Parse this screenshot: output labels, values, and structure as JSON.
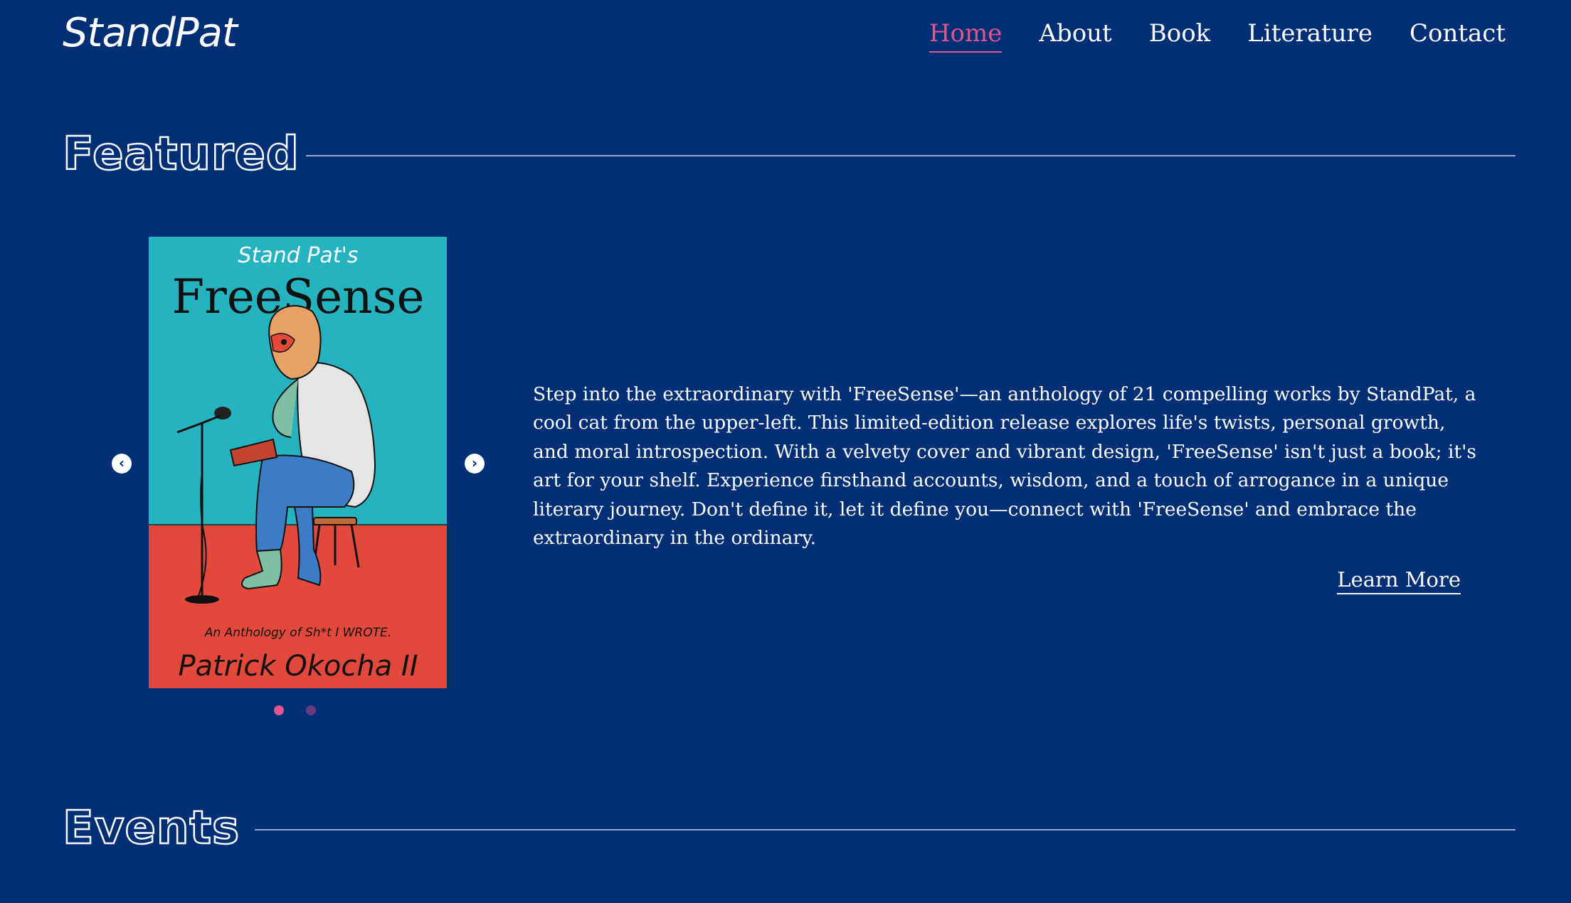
{
  "header": {
    "logo": "StandPat",
    "nav": [
      {
        "label": "Home",
        "active": true
      },
      {
        "label": "About",
        "active": false
      },
      {
        "label": "Book",
        "active": false
      },
      {
        "label": "Literature",
        "active": false
      },
      {
        "label": "Contact",
        "active": false
      }
    ]
  },
  "featured": {
    "heading": "Featured",
    "book": {
      "cover_top_text": "Stand Pat's",
      "cover_title": "FreeSense",
      "cover_subtitle": "An Anthology of Sh*t I WROTE.",
      "cover_author": "Patrick Okocha II"
    },
    "description": "Step into the extraordinary with 'FreeSense'—an anthology of 21 compelling works by StandPat, a cool cat from the upper-left. This limited-edition release explores life's twists, personal growth, and moral introspection. With a velvety cover and vibrant design, 'FreeSense' isn't just a book; it's art for your shelf. Experience firsthand accounts, wisdom, and a touch of arrogance in a unique literary journey. Don't define it, let it define you—connect with 'FreeSense' and embrace the extraordinary in the ordinary.",
    "cta": "Learn More",
    "carousel": {
      "prev_icon": "chevron-left-icon",
      "next_icon": "chevron-right-icon",
      "slide_count": 2,
      "active_slide": 1
    }
  },
  "events": {
    "heading": "Events"
  },
  "colors": {
    "background": "#002f75",
    "accent": "#e3558d",
    "text": "#ffffff",
    "dot_inactive": "#6a3a7e"
  }
}
